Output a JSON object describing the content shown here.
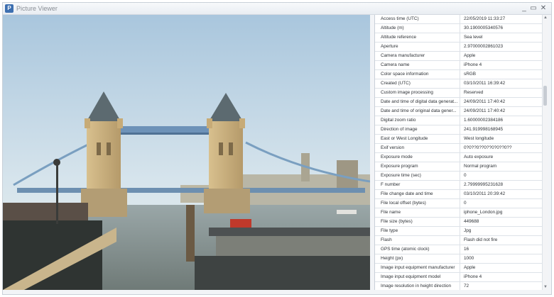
{
  "window": {
    "title": "Picture Viewer",
    "controls": {
      "minimize": "_",
      "maximize": "▭",
      "close": "✕"
    }
  },
  "image": {
    "subject": "Tower Bridge, London"
  },
  "properties": [
    {
      "name": "Access time (UTC)",
      "value": "22/05/2019 11:33:27"
    },
    {
      "name": "Altitude (m)",
      "value": "30.1900005340576"
    },
    {
      "name": "Altitude reference",
      "value": "Sea level"
    },
    {
      "name": "Aperture",
      "value": "2.97000002861023"
    },
    {
      "name": "Camera manufacturer",
      "value": "Apple"
    },
    {
      "name": "Camera name",
      "value": "iPhone 4"
    },
    {
      "name": "Color space information",
      "value": "sRGB"
    },
    {
      "name": "Created (UTC)",
      "value": "03/10/2011 16:39:42"
    },
    {
      "name": "Custom image processing",
      "value": "Reserved"
    },
    {
      "name": "Date and time of digital data generat...",
      "value": "24/09/2011 17:40:42"
    },
    {
      "name": "Date and time of original data gener...",
      "value": "24/09/2011 17:40:42"
    },
    {
      "name": "Digital zoom ratio",
      "value": "1.60000002384186"
    },
    {
      "name": "Direction of image",
      "value": "241.919998168945"
    },
    {
      "name": "East or West Longitude",
      "value": "West longitude"
    },
    {
      "name": "Exif version",
      "value": "0?0??0??0??0?0??0??"
    },
    {
      "name": "Exposure mode",
      "value": "Auto exposure"
    },
    {
      "name": "Exposure program",
      "value": "Normal program"
    },
    {
      "name": "Exposure time (sec)",
      "value": "0"
    },
    {
      "name": "F number",
      "value": "2.79999995231628"
    },
    {
      "name": "File change date and time",
      "value": "03/10/2011 20:39:42"
    },
    {
      "name": "File local offset (bytes)",
      "value": "0"
    },
    {
      "name": "File name",
      "value": "iphone_London.jpg"
    },
    {
      "name": "File size (bytes)",
      "value": "449688"
    },
    {
      "name": "File type",
      "value": "Jpg"
    },
    {
      "name": "Flash",
      "value": "Flash did not fire"
    },
    {
      "name": "GPS time (atomic clock)",
      "value": "16"
    },
    {
      "name": "Height (px)",
      "value": "1000"
    },
    {
      "name": "Image input equipment manufacturer",
      "value": "Apple"
    },
    {
      "name": "Image input equipment model",
      "value": "iPhone 4"
    },
    {
      "name": "Image resolution in height direction",
      "value": "72"
    }
  ],
  "scrollbar": {
    "up": "▲",
    "down": "▼"
  },
  "colors": {
    "accent": "#3d6fb0",
    "border": "#c9d0d8",
    "row_divider": "#dde2e8"
  }
}
